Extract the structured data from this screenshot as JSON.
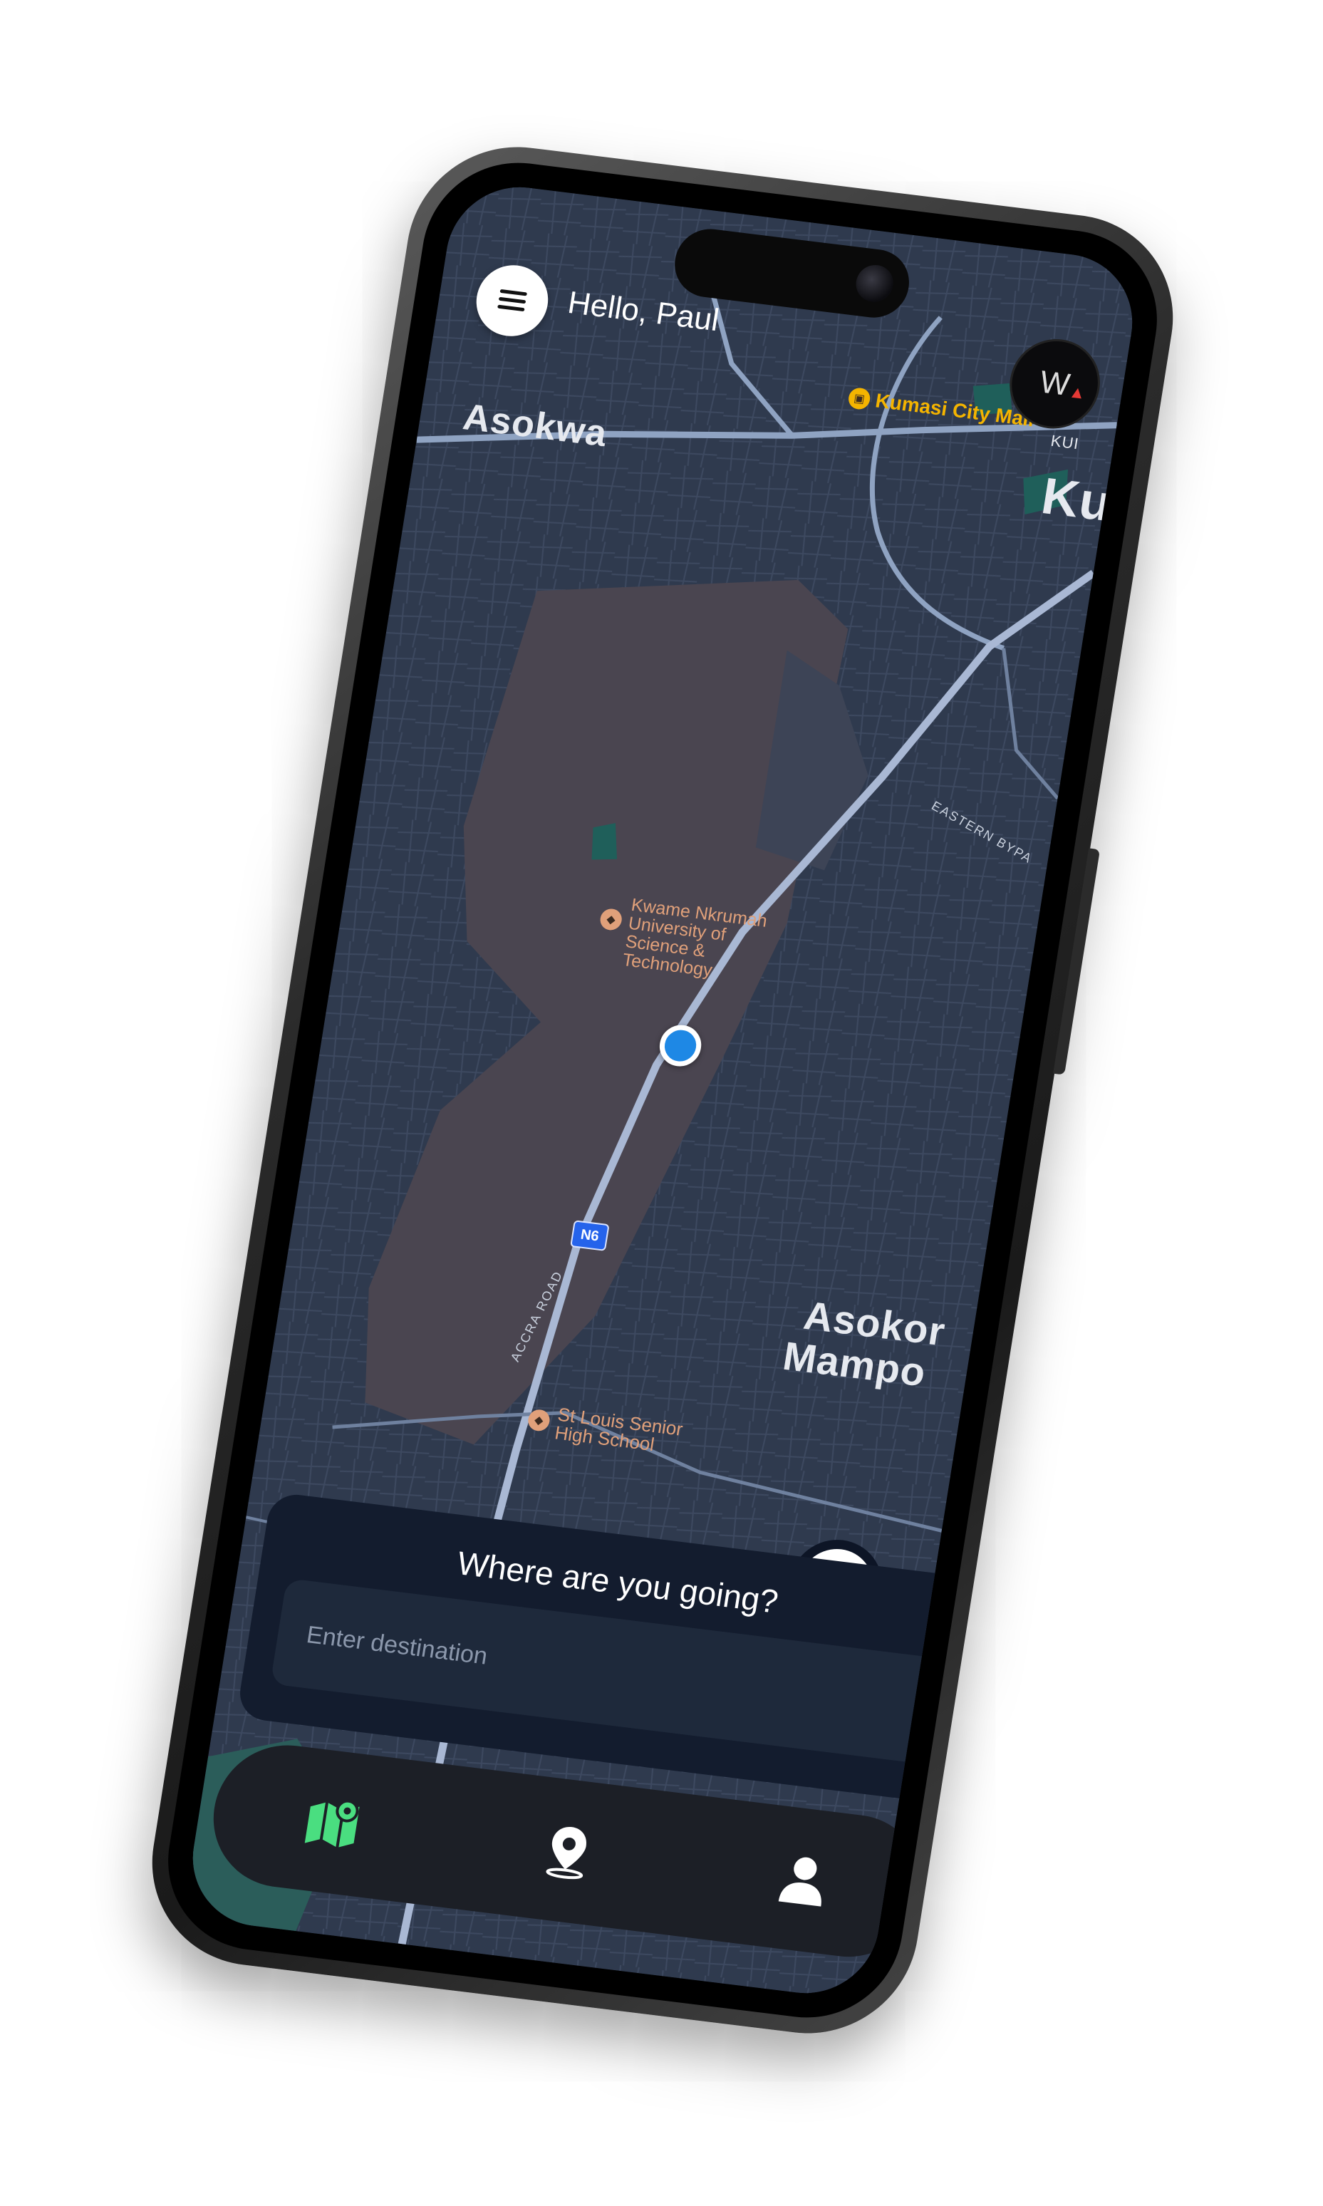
{
  "header": {
    "greeting": "Hello, Paul",
    "compass_letter": "W"
  },
  "map": {
    "places": {
      "asokwa": "Asokwa",
      "kumasi_short": "Ku",
      "kumasi_tiny": "KUI",
      "asokore_line1": "Asokor",
      "asokore_line2": "Mampo"
    },
    "pois": {
      "mall": "Kumasi City Mall",
      "knust": "Kwame Nkrumah University of Science & Technology",
      "school": "St Louis Senior High School"
    },
    "roads": {
      "shield": "N6",
      "accra_road": "ACCRA ROAD",
      "eastern_bypass": "EASTERN BYPA"
    }
  },
  "destination": {
    "title": "Where are you going?",
    "placeholder": "Enter destination"
  },
  "nav": {
    "items": [
      {
        "icon": "map-icon",
        "active": true
      },
      {
        "icon": "location-pin-icon",
        "active": false
      },
      {
        "icon": "user-icon",
        "active": false
      }
    ]
  },
  "colors": {
    "accent": "#4ade80",
    "map_bg": "#2f3a4e",
    "campus": "#4a4550",
    "road": "#8fa3c2",
    "card": "#131c2e"
  }
}
